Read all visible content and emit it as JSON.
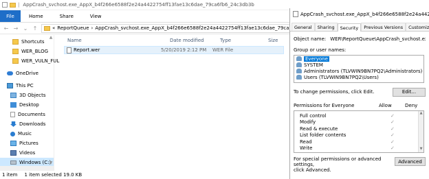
{
  "explorer": {
    "title": "AppCrash_svchost.exe_AppX_b4f266e6588f2e24a4422754ff13fae13c6dae_79ca6fb6_24c3db3b",
    "ribbon_tabs": [
      "File",
      "Home",
      "Share",
      "View"
    ],
    "breadcrumb": {
      "sep1": "«",
      "part1": "ReportQueue",
      "sep2": "›",
      "part2": "AppCrash_svchost.exe_AppX_b4f266e6588f2e24a4422754ff13fae13c6dae_79ca6fb6_24c3db3b"
    },
    "nav_items": [
      {
        "label": "Shortcuts",
        "icon": "folder-icon"
      },
      {
        "label": "WER_BLOG",
        "icon": "folder-icon"
      },
      {
        "label": "WER_VULN_FUL",
        "icon": "folder-icon"
      },
      {
        "label": "OneDrive",
        "icon": "cloud-icon"
      },
      {
        "label": "This PC",
        "icon": "computer-icon"
      },
      {
        "label": "3D Objects",
        "icon": "cube-icon"
      },
      {
        "label": "Desktop",
        "icon": "desktop-icon"
      },
      {
        "label": "Documents",
        "icon": "documents-icon"
      },
      {
        "label": "Downloads",
        "icon": "downloads-icon"
      },
      {
        "label": "Music",
        "icon": "music-icon"
      },
      {
        "label": "Pictures",
        "icon": "pictures-icon"
      },
      {
        "label": "Videos",
        "icon": "videos-icon"
      },
      {
        "label": "Windows (C:)",
        "icon": "drive-icon"
      }
    ],
    "columns": {
      "name": "Name",
      "date": "Date modified",
      "type": "Type",
      "size": "Size"
    },
    "files": [
      {
        "name": "Report.wer",
        "date": "5/20/2019 2:12 PM",
        "type": "WER File"
      }
    ],
    "status": {
      "count": "1 item",
      "selected": "1 item selected  19.0 KB"
    }
  },
  "dialog": {
    "title": "AppCrash_svchost.exe_AppX_b4f266e6588f2e24a44227...",
    "tabs": [
      "General",
      "Sharing",
      "Security",
      "Previous Versions",
      "Customize"
    ],
    "active_tab": "Security",
    "object_label": "Object name:",
    "object_value": "WER\\ReportQueue\\AppCrash_svchost.exe_AppX",
    "groups_label": "Group or user names:",
    "groups": [
      "Everyone",
      "SYSTEM",
      "Administrators (TLVWIN9BN7PQ2\\Administrators)",
      "Users (TLVWIN9BN7PQ2\\Users)"
    ],
    "change_text": "To change permissions, click Edit.",
    "edit_button": "Edit...",
    "perm_header": {
      "name": "Permissions for Everyone",
      "allow": "Allow",
      "deny": "Deny"
    },
    "permissions": [
      {
        "name": "Full control",
        "allow": "✓"
      },
      {
        "name": "Modify",
        "allow": "✓"
      },
      {
        "name": "Read & execute",
        "allow": "✓"
      },
      {
        "name": "List folder contents",
        "allow": "✓"
      },
      {
        "name": "Read",
        "allow": "✓"
      },
      {
        "name": "Write",
        "allow": "✓"
      }
    ],
    "advanced_text_1": "For special permissions or advanced settings,",
    "advanced_text_2": "click Advanced.",
    "advanced_button": "Advanced"
  },
  "colors": {
    "accent": "#1e6ec8",
    "selection": "#0078d7",
    "row_highlight": "#e5f1fb"
  }
}
